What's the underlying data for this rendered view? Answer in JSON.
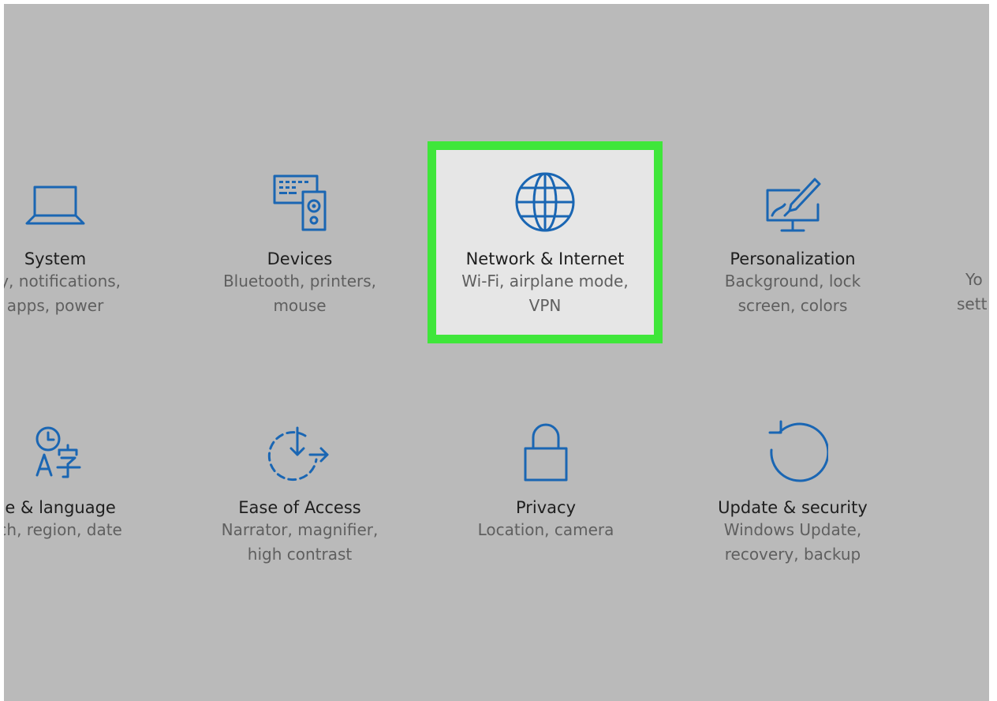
{
  "settings": {
    "tiles": [
      {
        "title": "System",
        "desc1": "ay, notifications,",
        "desc2": "apps, power",
        "icon": "laptop-icon"
      },
      {
        "title": "Devices",
        "desc1": "Bluetooth, printers,",
        "desc2": "mouse",
        "icon": "devices-icon"
      },
      {
        "title": "Network & Internet",
        "desc1": "Wi-Fi, airplane mode,",
        "desc2": "VPN",
        "icon": "globe-icon"
      },
      {
        "title": "Personalization",
        "desc1": "Background, lock",
        "desc2": "screen, colors",
        "icon": "personalization-icon"
      },
      {
        "title": "ne & language",
        "desc1": "ech, region, date",
        "desc2": "",
        "icon": "time-language-icon"
      },
      {
        "title": "Ease of Access",
        "desc1": "Narrator, magnifier,",
        "desc2": "high contrast",
        "icon": "ease-of-access-icon"
      },
      {
        "title": "Privacy",
        "desc1": "Location, camera",
        "desc2": "",
        "icon": "lock-icon"
      },
      {
        "title": "Update & security",
        "desc1": "Windows Update,",
        "desc2": "recovery, backup",
        "icon": "update-icon"
      }
    ],
    "partial_right": {
      "line1": "Yo",
      "line2": "sett"
    },
    "colors": {
      "background": "#bababa",
      "icon_accent": "#1a66b3",
      "highlight_border": "#3fe63a",
      "selected_tile": "#e6e6e6"
    }
  }
}
